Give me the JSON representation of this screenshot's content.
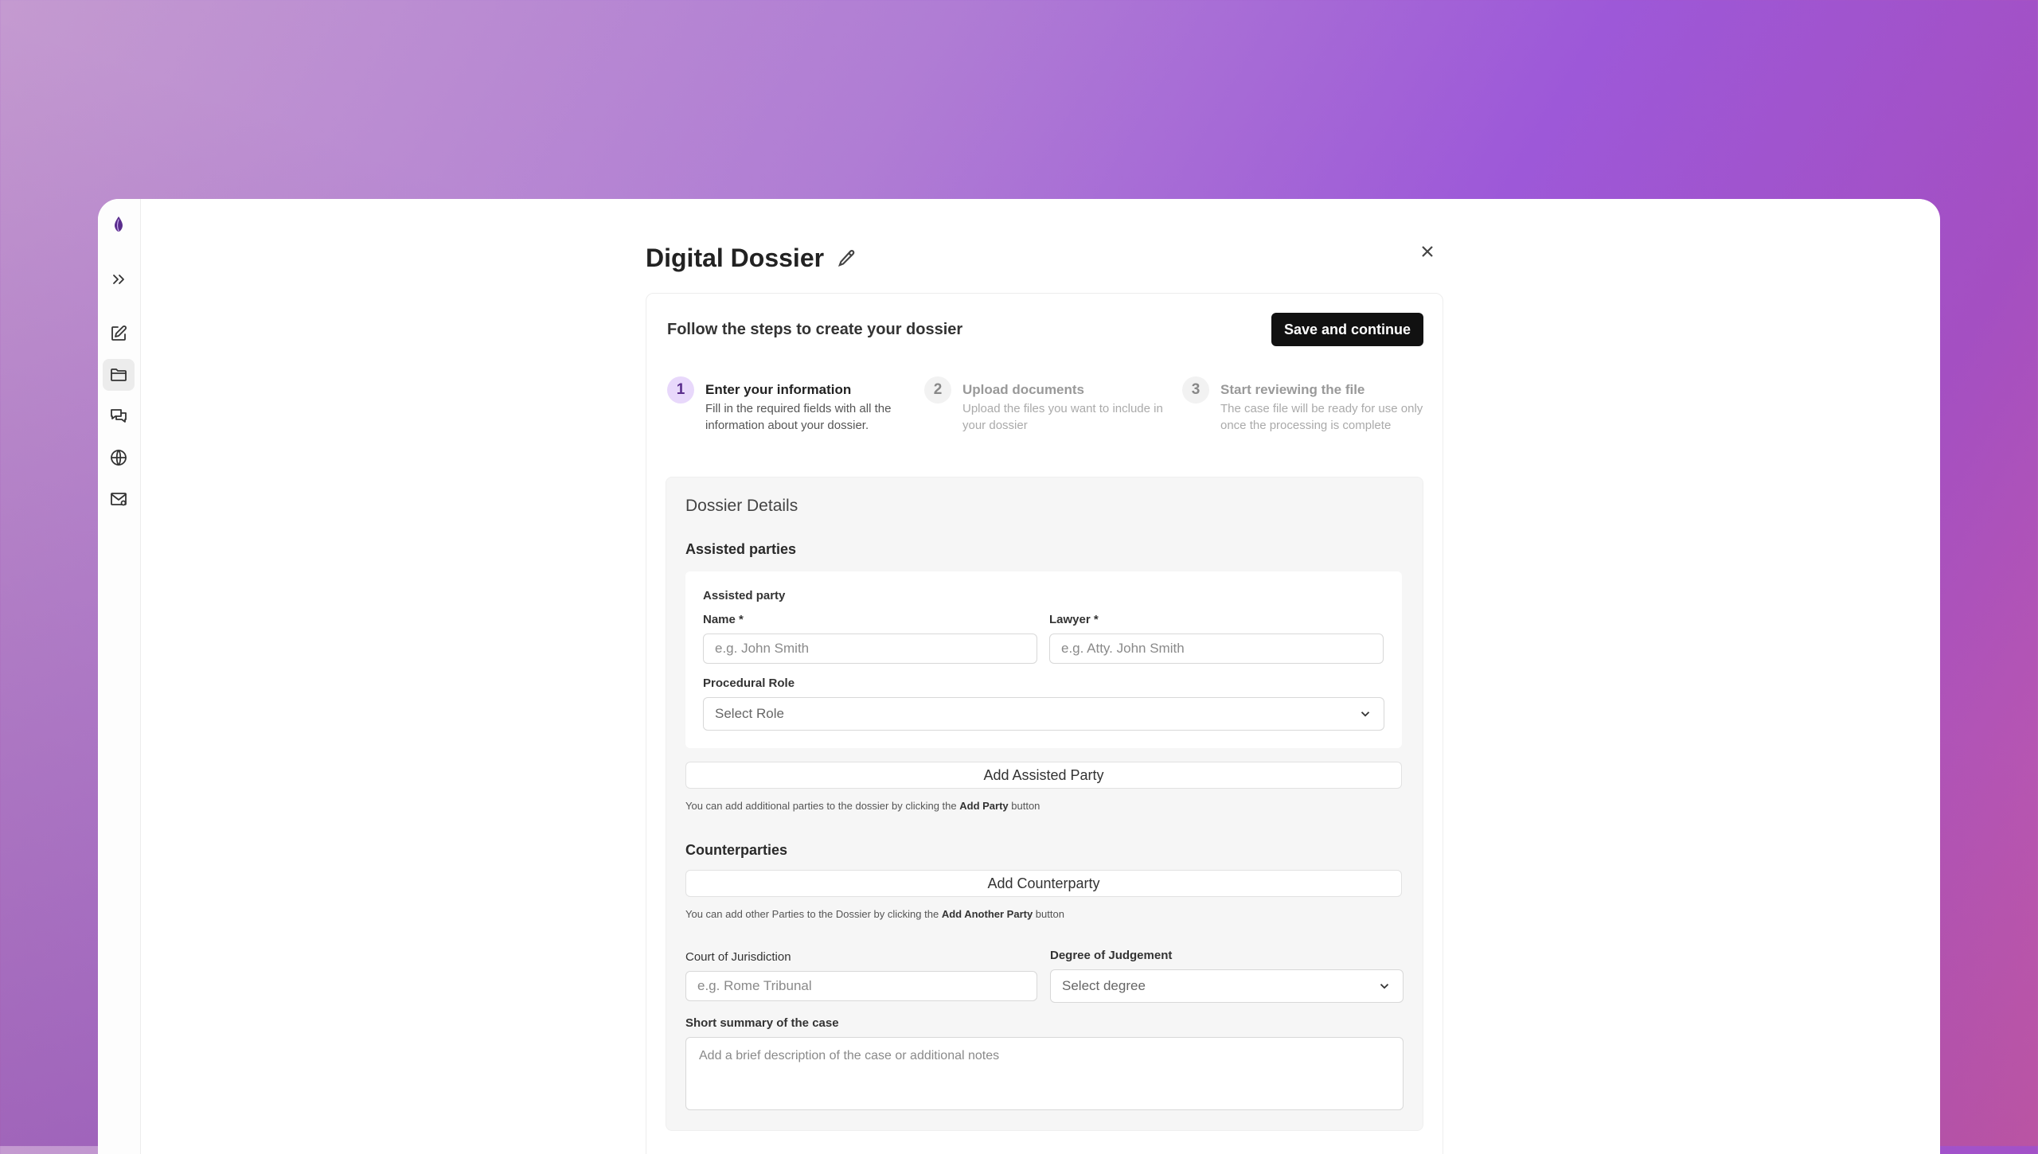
{
  "sidebar": {
    "items": [
      {
        "name": "logo-icon"
      },
      {
        "name": "expand-icon"
      },
      {
        "name": "new-note-icon"
      },
      {
        "name": "folder-icon"
      },
      {
        "name": "chat-icon"
      },
      {
        "name": "globe-icon"
      },
      {
        "name": "mail-icon"
      }
    ]
  },
  "header": {
    "title": "Digital Dossier"
  },
  "card": {
    "heading": "Follow the steps to create your dossier",
    "save_label": "Save and continue"
  },
  "steps": [
    {
      "number": "1",
      "title": "Enter your information",
      "description": "Fill in the required fields with all the information about your dossier."
    },
    {
      "number": "2",
      "title": "Upload documents",
      "description": "Upload the files you want to include in your dossier"
    },
    {
      "number": "3",
      "title": "Start reviewing the file",
      "description": "The case file will be ready for use only once the processing is complete"
    }
  ],
  "details": {
    "title": "Dossier Details",
    "assisted_parties": {
      "section_title": "Assisted parties",
      "party_title": "Assisted party",
      "name_label": "Name *",
      "name_placeholder": "e.g. John Smith",
      "lawyer_label": "Lawyer *",
      "lawyer_placeholder": "e.g. Atty. John Smith",
      "role_label": "Procedural Role",
      "role_value": "Select Role",
      "add_button": "Add Assisted Party",
      "hint_prefix": "You can add additional parties to the dossier by clicking the ",
      "hint_bold": "Add Party",
      "hint_suffix": " button"
    },
    "counterparties": {
      "section_title": "Counterparties",
      "add_button": "Add Counterparty",
      "hint_prefix": "You can add other Parties to the Dossier by clicking the ",
      "hint_bold": "Add Another Party",
      "hint_suffix": " button"
    },
    "court": {
      "label": "Court of Jurisdiction",
      "placeholder": "e.g. Rome Tribunal"
    },
    "degree": {
      "label": "Degree of Judgement",
      "value": "Select degree"
    },
    "summary": {
      "label": "Short summary of the case",
      "placeholder": "Add a brief description of the case or additional notes"
    }
  },
  "colors": {
    "accent": "#5a2d8c",
    "step_active_bg": "#e8d8fb",
    "button_dark": "#111111"
  }
}
